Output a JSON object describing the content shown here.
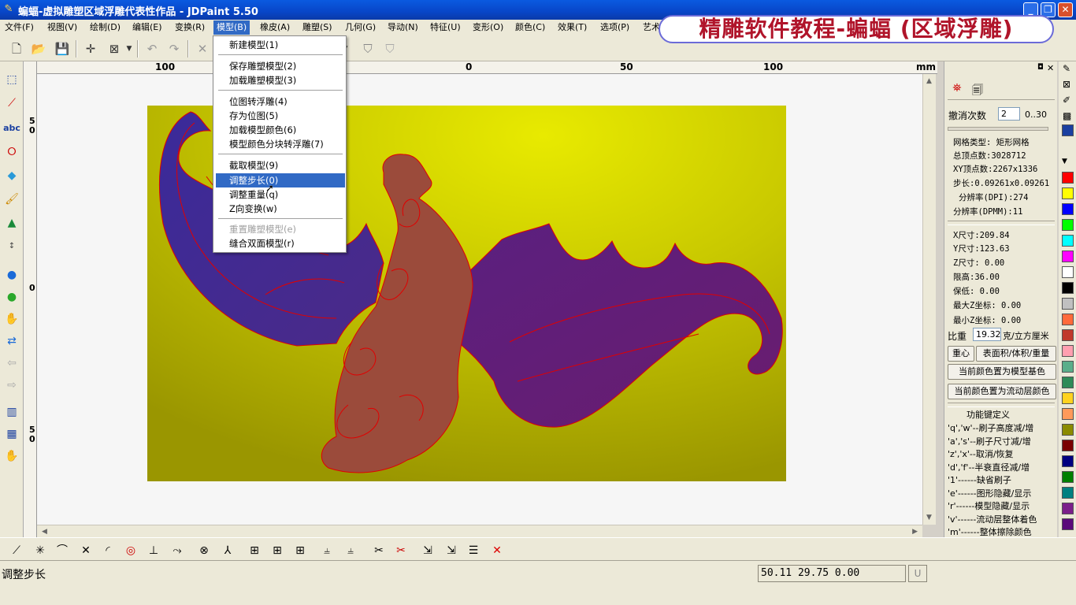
{
  "window": {
    "title": "蝙蝠-虚拟雕塑区域浮雕代表性作品 - JDPaint 5.50"
  },
  "banner": {
    "text": "精雕软件教程-蝙蝠 (区域浮雕)"
  },
  "menubar": [
    "文件(F)",
    "视图(V)",
    "绘制(D)",
    "编辑(E)",
    "变换(R)",
    "模型(B)",
    "橡皮(A)",
    "雕塑(S)",
    "几何(G)",
    "导动(N)",
    "特征(U)",
    "变形(O)",
    "颜色(C)",
    "效果(T)",
    "选项(P)",
    "艺术"
  ],
  "model_menu": {
    "items": [
      {
        "label": "新建模型(1)",
        "enabled": true,
        "selected": false
      },
      {
        "label": "保存雕塑模型(2)",
        "enabled": true,
        "selected": false
      },
      {
        "label": "加载雕塑模型(3)",
        "enabled": true,
        "selected": false
      },
      {
        "label": "位图转浮雕(4)",
        "enabled": true,
        "selected": false
      },
      {
        "label": "存为位图(5)",
        "enabled": true,
        "selected": false
      },
      {
        "label": "加载模型颜色(6)",
        "enabled": true,
        "selected": false
      },
      {
        "label": "模型颜色分块转浮雕(7)",
        "enabled": true,
        "selected": false
      },
      {
        "label": "截取模型(9)",
        "enabled": true,
        "selected": false
      },
      {
        "label": "调整步长(0)",
        "enabled": true,
        "selected": true
      },
      {
        "label": "调整重量(q)",
        "enabled": true,
        "selected": false
      },
      {
        "label": "Z向变换(w)",
        "enabled": true,
        "selected": false
      },
      {
        "label": "重置雕塑模型(e)",
        "enabled": false,
        "selected": false
      },
      {
        "label": "缝合双面模型(r)",
        "enabled": true,
        "selected": false
      }
    ]
  },
  "ruler": {
    "h_labels": [
      "100",
      "50",
      "0",
      "50",
      "100"
    ],
    "unit": "mm",
    "v_labels": [
      "5\n0",
      "0",
      "5\n0"
    ]
  },
  "right_panel": {
    "undo_label": "撤消次数",
    "undo_value": "2",
    "undo_range": "0..30",
    "grid_type": "网格类型: 矩形网格",
    "total_vertices": "总顶点数:3028712",
    "xy_vertices": "XY顶点数:2267x1336",
    "step": "步长:0.09261x0.09261",
    "dpi": "分辨率(DPI):274",
    "dpmm": "分辨率(DPMM):11",
    "x_size": "X尺寸:209.84",
    "y_size": "Y尺寸:123.63",
    "z_size": "Z尺寸: 0.00",
    "height_limit": "限高:36.00",
    "base": "保低: 0.00",
    "max_z": "最大Z坐标: 0.00",
    "min_z": "最小Z坐标: 0.00",
    "density_label": "比重",
    "density_value": "19.32",
    "density_unit": "克/立方厘米",
    "btn_center": "重心",
    "btn_area": "表面积/体积/重量",
    "btn_base_color": "当前颜色置为模型基色",
    "btn_flow_color": "当前颜色置为流动层颜色",
    "keys_title": "功能键定义",
    "keys": [
      "'q','w'--刷子高度减/增",
      "'a','s'--刷子尺寸减/增",
      "'z','x'--取消/恢复",
      "'d','f'--半衰直径减/增",
      "'1'------缺省刷子",
      "'e'------图形隐藏/显示",
      "'r'------模型隐藏/显示",
      "'v'------流动层整体着色",
      "'m'------整体擦除颜色"
    ]
  },
  "palette": [
    "#1a3fa0",
    "#ff0000",
    "#ffff00",
    "#0000ff",
    "#00ff00",
    "#00ffff",
    "#ff00ff",
    "#ffffff",
    "#000000",
    "#c0c0c0",
    "#ff6a3a",
    "#c0392b",
    "#ff9fb0",
    "#5aae8a",
    "#2e8b57",
    "#ffd21f",
    "#ff9a5a",
    "#8b8b00",
    "#7a0000",
    "#000080",
    "#008000",
    "#008080",
    "#7b1f8a",
    "#5a0a7a"
  ],
  "colors": {
    "accent": "#316ac5",
    "model_bg": "#c8c800",
    "wing": "#4a2a9a",
    "body": "#9a4a3a",
    "outline": "#e00000"
  },
  "status": {
    "text": "调整步长",
    "coords": "50.11 29.75 0.00",
    "u_label": "U"
  }
}
